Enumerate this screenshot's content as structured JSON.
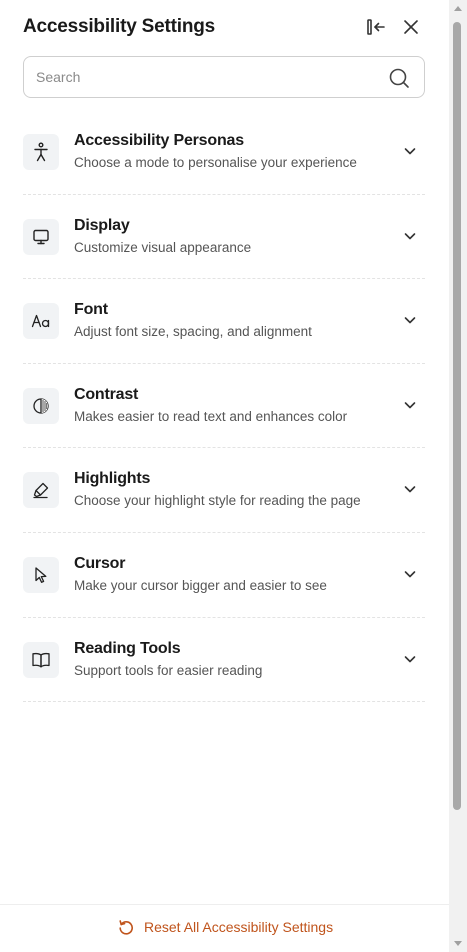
{
  "header": {
    "title": "Accessibility Settings",
    "collapse_icon": "collapse-panel-icon",
    "close_icon": "close-icon"
  },
  "search": {
    "placeholder": "Search",
    "value": "",
    "icon": "search-icon"
  },
  "items": [
    {
      "title": "Accessibility Personas",
      "description": "Choose a mode to personalise your experience",
      "icon": "person-icon"
    },
    {
      "title": "Display",
      "description": "Customize visual appearance",
      "icon": "monitor-icon"
    },
    {
      "title": "Font",
      "description": "Adjust font size, spacing, and alignment",
      "icon": "font-icon"
    },
    {
      "title": "Contrast",
      "description": "Makes easier to read text and enhances color",
      "icon": "contrast-icon"
    },
    {
      "title": "Highlights",
      "description": "Choose your highlight style for reading the page",
      "icon": "highlighter-icon"
    },
    {
      "title": "Cursor",
      "description": "Make your cursor bigger and easier to see",
      "icon": "cursor-icon"
    },
    {
      "title": "Reading Tools",
      "description": "Support tools for easier reading",
      "icon": "book-icon"
    }
  ],
  "footer": {
    "reset_label": "Reset All Accessibility Settings",
    "reset_icon": "reset-icon"
  },
  "colors": {
    "accent": "#c0541c",
    "icon_box": "#f1f3f5",
    "text": "#1a1a1a",
    "muted": "#555555"
  }
}
